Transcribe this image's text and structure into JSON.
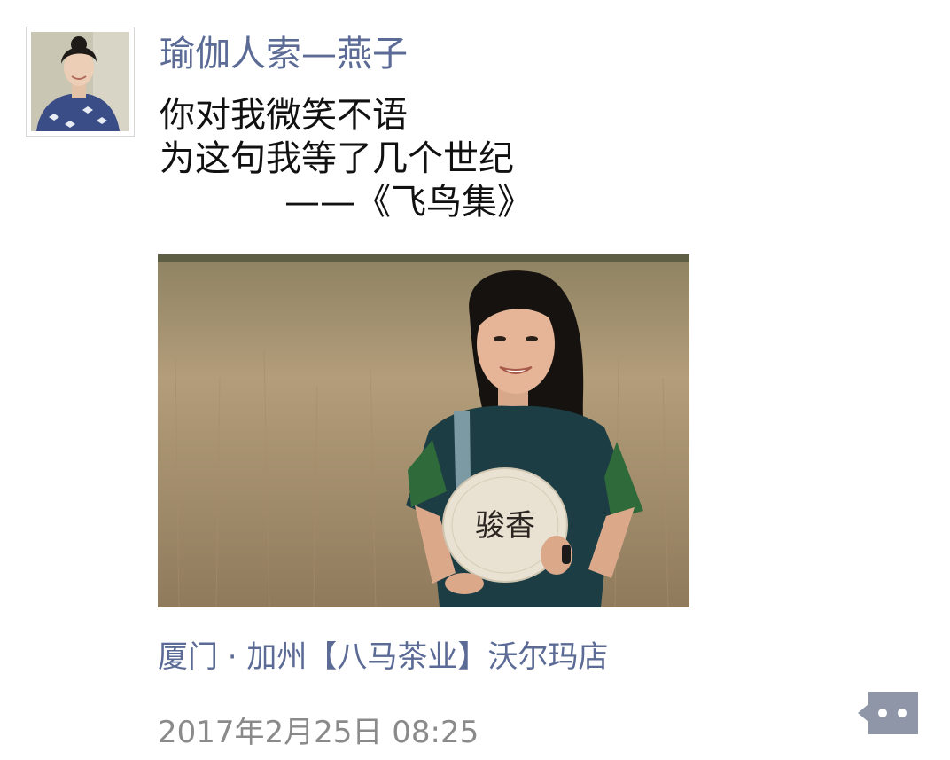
{
  "post": {
    "author": "瑜伽人索—燕子",
    "text_lines": [
      "你对我微笑不语",
      "为这句我等了几个世纪",
      "——《飞鸟集》"
    ],
    "location": "厦门 · 加州【八马茶业】沃尔玛店",
    "timestamp": "2017年2月25日 08:25",
    "tea_cake_label": "骏香"
  },
  "icons": {
    "comment": "more-options-icon"
  },
  "colors": {
    "name_link": "#5b6b96",
    "body_text": "#111111",
    "timestamp": "#8a8a8a",
    "comment_button": "#8e96a8"
  }
}
